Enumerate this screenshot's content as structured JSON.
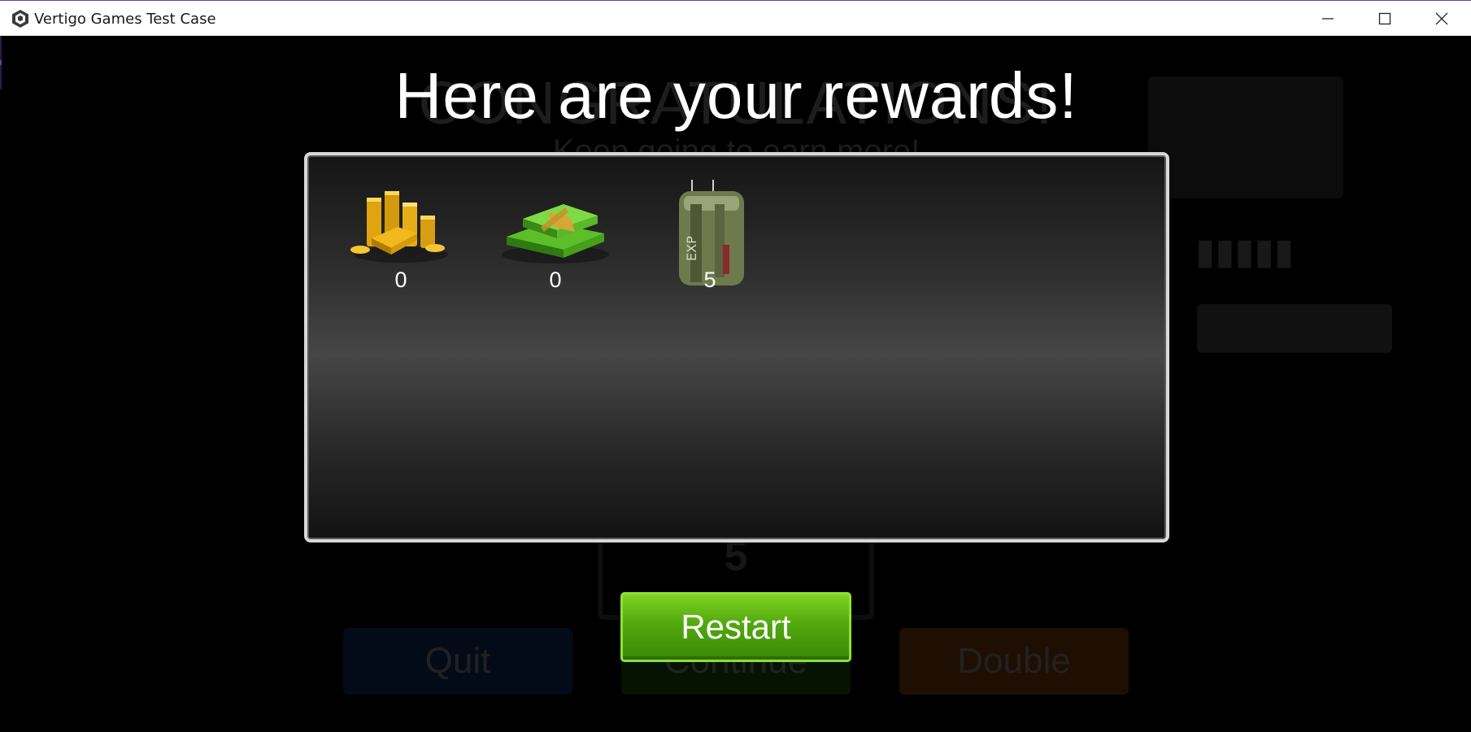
{
  "window": {
    "title": "Vertigo Games Test Case"
  },
  "background": {
    "title": "CONGRATULATIONS!",
    "subtitle": "Keep going to earn more!",
    "wheel_value": "5",
    "quit_label": "Quit",
    "continue_label": "Continue",
    "double_label": "Double"
  },
  "rewards_screen": {
    "headline": "Here are your rewards!",
    "items": [
      {
        "name": "gold-icon",
        "amount": "0"
      },
      {
        "name": "cash-icon",
        "amount": "0"
      },
      {
        "name": "exp-bag-icon",
        "amount": "5"
      }
    ],
    "restart_label": "Restart"
  },
  "colors": {
    "restart_green": "#52a80e",
    "panel_border": "#d8d8d8",
    "quit_blue": "#1d4fa8",
    "double_orange": "#d06a10"
  }
}
